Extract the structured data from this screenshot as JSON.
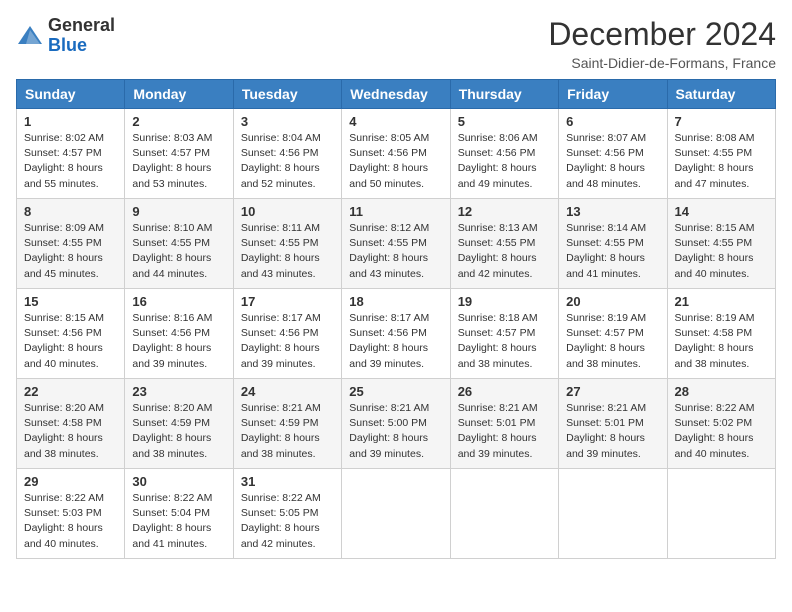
{
  "header": {
    "logo_general": "General",
    "logo_blue": "Blue",
    "month_title": "December 2024",
    "location": "Saint-Didier-de-Formans, France"
  },
  "weekdays": [
    "Sunday",
    "Monday",
    "Tuesday",
    "Wednesday",
    "Thursday",
    "Friday",
    "Saturday"
  ],
  "weeks": [
    [
      {
        "day": "1",
        "sunrise": "8:02 AM",
        "sunset": "4:57 PM",
        "daylight": "8 hours and 55 minutes."
      },
      {
        "day": "2",
        "sunrise": "8:03 AM",
        "sunset": "4:57 PM",
        "daylight": "8 hours and 53 minutes."
      },
      {
        "day": "3",
        "sunrise": "8:04 AM",
        "sunset": "4:56 PM",
        "daylight": "8 hours and 52 minutes."
      },
      {
        "day": "4",
        "sunrise": "8:05 AM",
        "sunset": "4:56 PM",
        "daylight": "8 hours and 50 minutes."
      },
      {
        "day": "5",
        "sunrise": "8:06 AM",
        "sunset": "4:56 PM",
        "daylight": "8 hours and 49 minutes."
      },
      {
        "day": "6",
        "sunrise": "8:07 AM",
        "sunset": "4:56 PM",
        "daylight": "8 hours and 48 minutes."
      },
      {
        "day": "7",
        "sunrise": "8:08 AM",
        "sunset": "4:55 PM",
        "daylight": "8 hours and 47 minutes."
      }
    ],
    [
      {
        "day": "8",
        "sunrise": "8:09 AM",
        "sunset": "4:55 PM",
        "daylight": "8 hours and 45 minutes."
      },
      {
        "day": "9",
        "sunrise": "8:10 AM",
        "sunset": "4:55 PM",
        "daylight": "8 hours and 44 minutes."
      },
      {
        "day": "10",
        "sunrise": "8:11 AM",
        "sunset": "4:55 PM",
        "daylight": "8 hours and 43 minutes."
      },
      {
        "day": "11",
        "sunrise": "8:12 AM",
        "sunset": "4:55 PM",
        "daylight": "8 hours and 43 minutes."
      },
      {
        "day": "12",
        "sunrise": "8:13 AM",
        "sunset": "4:55 PM",
        "daylight": "8 hours and 42 minutes."
      },
      {
        "day": "13",
        "sunrise": "8:14 AM",
        "sunset": "4:55 PM",
        "daylight": "8 hours and 41 minutes."
      },
      {
        "day": "14",
        "sunrise": "8:15 AM",
        "sunset": "4:55 PM",
        "daylight": "8 hours and 40 minutes."
      }
    ],
    [
      {
        "day": "15",
        "sunrise": "8:15 AM",
        "sunset": "4:56 PM",
        "daylight": "8 hours and 40 minutes."
      },
      {
        "day": "16",
        "sunrise": "8:16 AM",
        "sunset": "4:56 PM",
        "daylight": "8 hours and 39 minutes."
      },
      {
        "day": "17",
        "sunrise": "8:17 AM",
        "sunset": "4:56 PM",
        "daylight": "8 hours and 39 minutes."
      },
      {
        "day": "18",
        "sunrise": "8:17 AM",
        "sunset": "4:56 PM",
        "daylight": "8 hours and 39 minutes."
      },
      {
        "day": "19",
        "sunrise": "8:18 AM",
        "sunset": "4:57 PM",
        "daylight": "8 hours and 38 minutes."
      },
      {
        "day": "20",
        "sunrise": "8:19 AM",
        "sunset": "4:57 PM",
        "daylight": "8 hours and 38 minutes."
      },
      {
        "day": "21",
        "sunrise": "8:19 AM",
        "sunset": "4:58 PM",
        "daylight": "8 hours and 38 minutes."
      }
    ],
    [
      {
        "day": "22",
        "sunrise": "8:20 AM",
        "sunset": "4:58 PM",
        "daylight": "8 hours and 38 minutes."
      },
      {
        "day": "23",
        "sunrise": "8:20 AM",
        "sunset": "4:59 PM",
        "daylight": "8 hours and 38 minutes."
      },
      {
        "day": "24",
        "sunrise": "8:21 AM",
        "sunset": "4:59 PM",
        "daylight": "8 hours and 38 minutes."
      },
      {
        "day": "25",
        "sunrise": "8:21 AM",
        "sunset": "5:00 PM",
        "daylight": "8 hours and 39 minutes."
      },
      {
        "day": "26",
        "sunrise": "8:21 AM",
        "sunset": "5:01 PM",
        "daylight": "8 hours and 39 minutes."
      },
      {
        "day": "27",
        "sunrise": "8:21 AM",
        "sunset": "5:01 PM",
        "daylight": "8 hours and 39 minutes."
      },
      {
        "day": "28",
        "sunrise": "8:22 AM",
        "sunset": "5:02 PM",
        "daylight": "8 hours and 40 minutes."
      }
    ],
    [
      {
        "day": "29",
        "sunrise": "8:22 AM",
        "sunset": "5:03 PM",
        "daylight": "8 hours and 40 minutes."
      },
      {
        "day": "30",
        "sunrise": "8:22 AM",
        "sunset": "5:04 PM",
        "daylight": "8 hours and 41 minutes."
      },
      {
        "day": "31",
        "sunrise": "8:22 AM",
        "sunset": "5:05 PM",
        "daylight": "8 hours and 42 minutes."
      },
      null,
      null,
      null,
      null
    ]
  ]
}
